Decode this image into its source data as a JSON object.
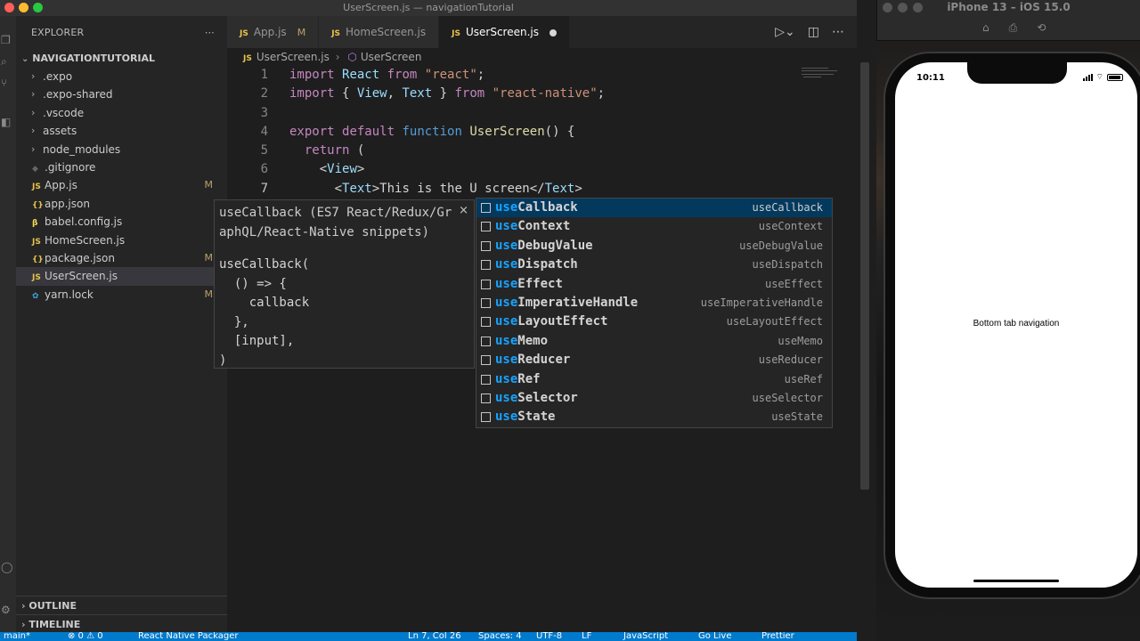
{
  "window_title": "UserScreen.js — navigationTutorial",
  "sidebar": {
    "header": "EXPLORER",
    "project": "NAVIGATIONTUTORIAL",
    "items": [
      {
        "label": ".expo",
        "icon": "chevron-right-icon",
        "modified": ""
      },
      {
        "label": ".expo-shared",
        "icon": "chevron-right-icon",
        "modified": ""
      },
      {
        "label": ".vscode",
        "icon": "chevron-right-icon",
        "modified": ""
      },
      {
        "label": "assets",
        "icon": "chevron-right-icon",
        "modified": ""
      },
      {
        "label": "node_modules",
        "icon": "chevron-right-icon",
        "modified": ""
      },
      {
        "label": ".gitignore",
        "icon": "git-icon",
        "modified": ""
      },
      {
        "label": "App.js",
        "icon": "js-icon",
        "modified": "M"
      },
      {
        "label": "app.json",
        "icon": "json-icon",
        "modified": ""
      },
      {
        "label": "babel.config.js",
        "icon": "babel-icon",
        "modified": ""
      },
      {
        "label": "HomeScreen.js",
        "icon": "js-icon",
        "modified": ""
      },
      {
        "label": "package.json",
        "icon": "json-icon",
        "modified": "M"
      },
      {
        "label": "UserScreen.js",
        "icon": "js-icon",
        "modified": ""
      },
      {
        "label": "yarn.lock",
        "icon": "yarn-icon",
        "modified": "M"
      }
    ],
    "outline": "OUTLINE",
    "timeline": "TIMELINE"
  },
  "tabs": [
    {
      "label": "App.js",
      "badge": "M",
      "active": false
    },
    {
      "label": "HomeScreen.js",
      "badge": "",
      "active": false
    },
    {
      "label": "UserScreen.js",
      "badge": "",
      "active": true
    }
  ],
  "breadcrumb": {
    "file": "UserScreen.js",
    "symbol": "UserScreen"
  },
  "editor": {
    "line_numbers": [
      "1",
      "2",
      "3",
      "4",
      "5",
      "6",
      "7"
    ],
    "lines": [
      "import React from \"react\";",
      "import { View, Text } from \"react-native\";",
      "",
      "export default function UserScreen() {",
      "  return (",
      "    <View>",
      "      <Text>This is the U screen</Text>"
    ]
  },
  "doc_popup": {
    "title": "useCallback (ES7 React/Redux/Gr\naphQL/React-Native snippets)",
    "close": "×",
    "snippet": "useCallback(\n  () => {\n    callback\n  },\n  [input],\n)"
  },
  "suggestions": [
    {
      "label": "useCallback",
      "detail": "useCallback"
    },
    {
      "label": "useContext",
      "detail": "useContext"
    },
    {
      "label": "useDebugValue",
      "detail": "useDebugValue"
    },
    {
      "label": "useDispatch",
      "detail": "useDispatch"
    },
    {
      "label": "useEffect",
      "detail": "useEffect"
    },
    {
      "label": "useImperativeHandle",
      "detail": "useImperativeHandle"
    },
    {
      "label": "useLayoutEffect",
      "detail": "useLayoutEffect"
    },
    {
      "label": "useMemo",
      "detail": "useMemo"
    },
    {
      "label": "useReducer",
      "detail": "useReducer"
    },
    {
      "label": "useRef",
      "detail": "useRef"
    },
    {
      "label": "useSelector",
      "detail": "useSelector"
    },
    {
      "label": "useState",
      "detail": "useState"
    }
  ],
  "statusbar": {
    "branch": "main*",
    "problems": "⊗ 0 ⚠ 0",
    "packager": "React Native Packager",
    "position": "Ln 7, Col 26",
    "spaces": "Spaces: 4",
    "encoding": "UTF-8",
    "eol": "LF",
    "language": "JavaScript",
    "golive": "Go Live",
    "prettier": "Prettier"
  },
  "simulator": {
    "title": "iPhone 13 – iOS 15.0",
    "time": "10:11",
    "screen_text": "Bottom tab navigation"
  },
  "colors": {
    "accent": "#007acc",
    "selection": "#04395e",
    "highlight": "#18a3ff"
  }
}
